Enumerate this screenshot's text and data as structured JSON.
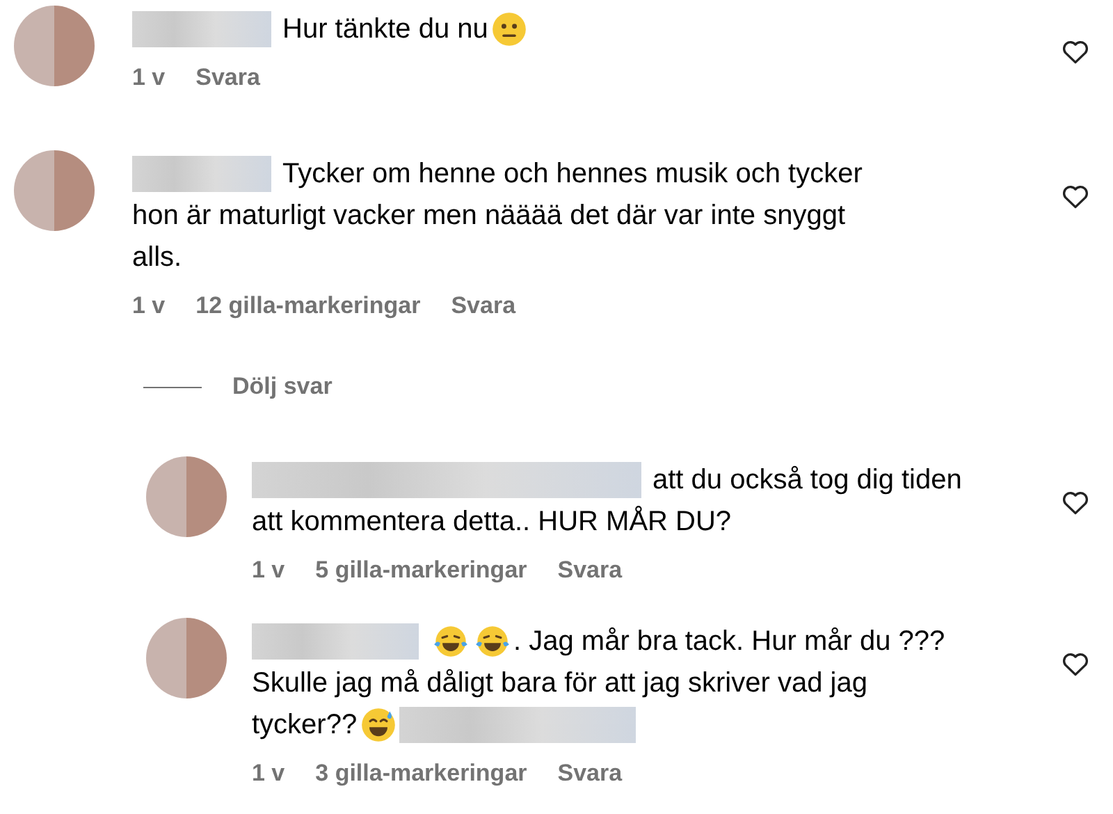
{
  "comments": [
    {
      "lines": [
        [
          {
            "kind": "blur"
          },
          {
            "kind": "text",
            "text": "Hur tänkte du nu"
          },
          {
            "kind": "neutral"
          }
        ]
      ],
      "meta": {
        "time": "1 v",
        "reply": "Svara"
      }
    },
    {
      "lines": [
        [
          {
            "kind": "blur"
          },
          {
            "kind": "text",
            "text": "Tycker om henne och hennes musik och tycker"
          }
        ],
        [
          {
            "kind": "text",
            "text": "hon är maturligt vacker men nääää det där var inte snyggt"
          }
        ],
        [
          {
            "kind": "text",
            "text": "alls."
          }
        ]
      ],
      "meta": {
        "time": "1 v",
        "likes": "12 gilla-markeringar",
        "reply": "Svara"
      },
      "replies_toggle": "Dölj svar",
      "replies": [
        {
          "lines": [
            [
              {
                "kind": "blur"
              },
              {
                "kind": "text",
                "text": "att du också tog dig tiden"
              }
            ],
            [
              {
                "kind": "text",
                "text": "att kommentera detta.. HUR MÅR DU?"
              }
            ]
          ],
          "meta": {
            "time": "1 v",
            "likes": "5 gilla-markeringar",
            "reply": "Svara"
          }
        },
        {
          "lines": [
            [
              {
                "kind": "blur"
              },
              {
                "kind": "laugh"
              },
              {
                "kind": "laugh"
              },
              {
                "kind": "text",
                "text": ". Jag mår bra tack. Hur mår du ???"
              }
            ],
            [
              {
                "kind": "text",
                "text": "Skulle jag må dåligt bara för att jag skriver vad jag"
              }
            ],
            [
              {
                "kind": "text",
                "text": "tycker??"
              },
              {
                "kind": "sweat"
              },
              {
                "kind": "blur"
              }
            ]
          ],
          "meta": {
            "time": "1 v",
            "likes": "3 gilla-markeringar",
            "reply": "Svara"
          }
        }
      ]
    }
  ]
}
